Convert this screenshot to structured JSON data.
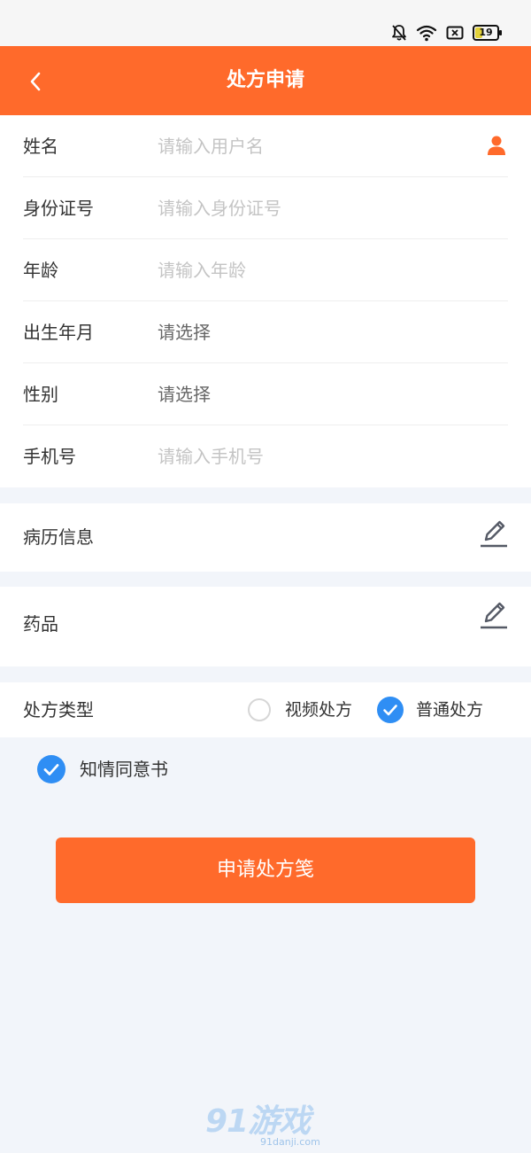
{
  "status_bar": {
    "battery_level": "19",
    "icons": [
      "bell-off-icon",
      "wifi-icon",
      "screen-record-icon",
      "battery-icon"
    ]
  },
  "header": {
    "title": "处方申请",
    "back_icon": "chevron-left-icon"
  },
  "form": {
    "name": {
      "label": "姓名",
      "placeholder": "请输入用户名",
      "value": ""
    },
    "id_number": {
      "label": "身份证号",
      "placeholder": "请输入身份证号",
      "value": ""
    },
    "age": {
      "label": "年龄",
      "placeholder": "请输入年龄",
      "value": ""
    },
    "birth_month": {
      "label": "出生年月",
      "value": "请选择"
    },
    "gender": {
      "label": "性别",
      "value": "请选择"
    },
    "phone": {
      "label": "手机号",
      "placeholder": "请输入手机号",
      "value": ""
    }
  },
  "medical_record": {
    "label": "病历信息",
    "icon": "pencil-edit-icon"
  },
  "medicine": {
    "label": "药品",
    "icon": "pencil-edit-icon"
  },
  "prescription_type": {
    "label": "处方类型",
    "options": [
      {
        "label": "视频处方",
        "checked": false
      },
      {
        "label": "普通处方",
        "checked": true
      }
    ]
  },
  "consent": {
    "label": "知情同意书",
    "checked": true
  },
  "submit": {
    "label": "申请处方笺"
  },
  "colors": {
    "primary": "#ff6a2b",
    "checked_blue": "#2f8ef4",
    "background": "#f2f5fa"
  },
  "watermark": {
    "main": "91游戏",
    "sub": "91danji.com"
  }
}
